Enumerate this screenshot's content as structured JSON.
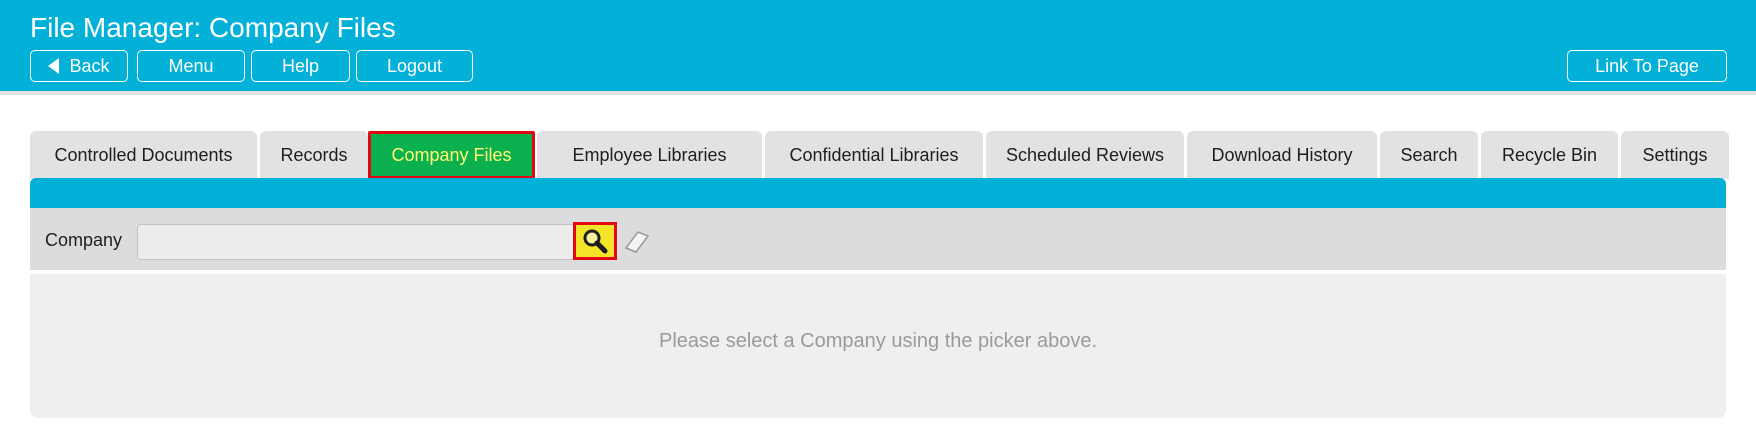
{
  "header": {
    "title": "File Manager: Company Files",
    "buttons": {
      "back": "Back",
      "menu": "Menu",
      "help": "Help",
      "logout": "Logout",
      "link_to_page": "Link To Page"
    }
  },
  "tabs": [
    {
      "label": "Controlled Documents",
      "active": false
    },
    {
      "label": "Records",
      "active": false
    },
    {
      "label": "Company Files",
      "active": true
    },
    {
      "label": "Employee Libraries",
      "active": false
    },
    {
      "label": "Confidential Libraries",
      "active": false
    },
    {
      "label": "Scheduled Reviews",
      "active": false
    },
    {
      "label": "Download History",
      "active": false
    },
    {
      "label": "Search",
      "active": false
    },
    {
      "label": "Recycle Bin",
      "active": false
    },
    {
      "label": "Settings",
      "active": false
    }
  ],
  "filter": {
    "label": "Company",
    "value": "",
    "search_icon": "magnifier-icon",
    "clear_icon": "eraser-icon"
  },
  "content": {
    "message": "Please select a Company using the picker above."
  },
  "colors": {
    "header_bg": "#02b0d8",
    "active_tab_bg": "#0bb14e",
    "active_tab_text": "#ffff73",
    "highlight_border": "#e30613",
    "search_button_bg": "#f5e52a"
  }
}
